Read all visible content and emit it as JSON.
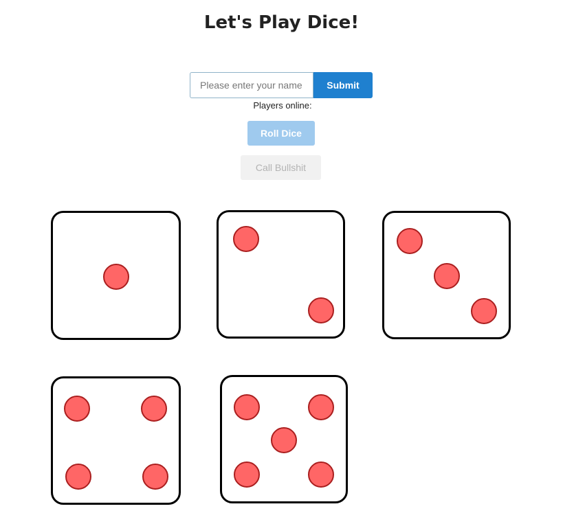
{
  "header": {
    "title": "Let's Play Dice!"
  },
  "form": {
    "name_placeholder": "Please enter your name",
    "name_value": "",
    "submit_label": "Submit"
  },
  "players": {
    "label": "Players online:"
  },
  "actions": {
    "roll_label": "Roll Dice",
    "roll_enabled": false,
    "call_label": "Call Bullshit",
    "call_enabled": false
  },
  "dice": [
    {
      "value": 1
    },
    {
      "value": 2
    },
    {
      "value": 3
    },
    {
      "value": 4
    },
    {
      "value": 5
    }
  ],
  "colors": {
    "pip_fill": "#ff6666",
    "pip_border": "#aa1f1f",
    "die_border": "#000000",
    "submit_bg": "#1f80cf",
    "roll_bg_disabled": "#9fcaee",
    "call_bg_disabled": "#f1f1f1"
  }
}
